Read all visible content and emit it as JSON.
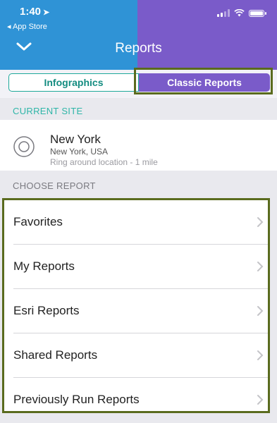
{
  "status_bar": {
    "time": "1:40",
    "back_app": "◂ App Store"
  },
  "nav": {
    "title": "Reports"
  },
  "segments": {
    "left_label": "Infographics",
    "right_label": "Classic Reports",
    "selected": "Classic Reports"
  },
  "current_site": {
    "section_label": "CURRENT SITE",
    "name": "New York",
    "region": "New York, USA",
    "description": "Ring around location - 1 mile"
  },
  "choose_report": {
    "section_label": "CHOOSE REPORT",
    "items": [
      {
        "label": "Favorites"
      },
      {
        "label": "My Reports"
      },
      {
        "label": "Esri Reports"
      },
      {
        "label": "Shared Reports"
      },
      {
        "label": "Previously Run Reports"
      }
    ]
  },
  "colors": {
    "header_left": "#2f93d6",
    "header_right": "#7a5bc9",
    "accent_teal": "#1ea89a",
    "highlight_border": "#5a6b1e"
  },
  "icons": {
    "location": "navigation-arrow-icon",
    "signal": "cellular-signal-icon",
    "wifi": "wifi-icon",
    "battery": "battery-icon",
    "collapse": "chevron-down-icon",
    "site": "target-circle-icon",
    "row": "chevron-right-icon"
  }
}
